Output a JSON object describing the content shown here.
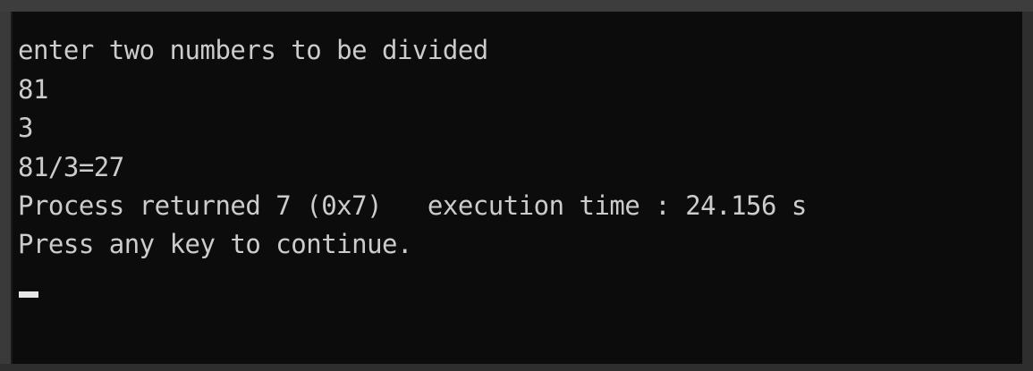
{
  "console": {
    "lines": [
      "enter two numbers to be divided",
      "81",
      "3",
      "81/3=27",
      "Process returned 7 (0x7)   execution time : 24.156 s",
      "Press any key to continue."
    ]
  },
  "colors": {
    "background": "#0c0c0c",
    "text": "#cccccc",
    "frame": "#3a3a3a"
  }
}
